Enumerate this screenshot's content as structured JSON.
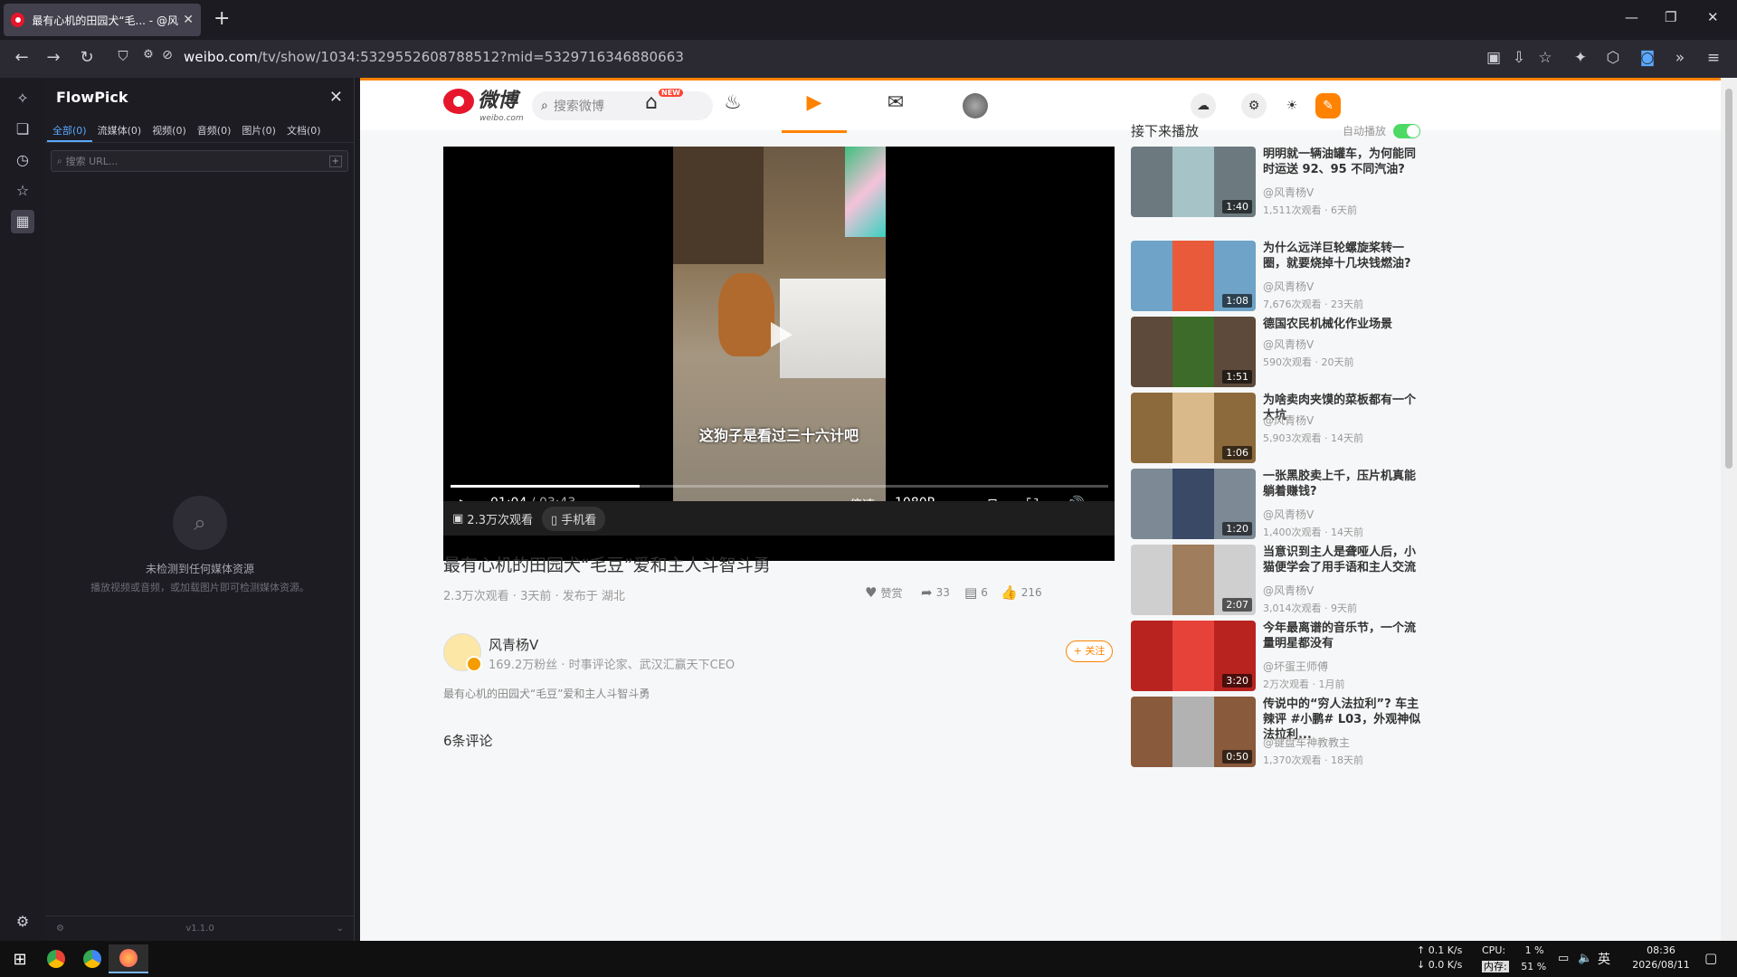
{
  "browser": {
    "tab_title": "最有心机的田园犬“毛... - @风青杨",
    "url_main": "weibo.com",
    "url_rest": "/tv/show/1034:5329552608788512?mid=5329716346880663"
  },
  "flowpick": {
    "title": "FlowPick",
    "tabs": [
      "全部(0)",
      "流媒体(0)",
      "视频(0)",
      "音频(0)",
      "图片(0)",
      "文档(0)"
    ],
    "search_placeholder": "搜索 URL...",
    "empty_title": "未检测到任何媒体资源",
    "empty_hint": "播放视频或音频，或加载图片即可检测媒体资源。",
    "version": "v1.1.0"
  },
  "weibo": {
    "logo_text": "微博",
    "logo_sub": "weibo.com",
    "search_placeholder": "搜索微博",
    "new_badge": "NEW"
  },
  "player": {
    "subtitle": "这狗子是看过三十六计吧",
    "current_time": "01:04",
    "duration": "03:43",
    "progress": 0.287,
    "speed_label": "倍速",
    "quality_label": "1080P",
    "views_label": "2.3万次观看",
    "mobile_label": "手机看"
  },
  "video": {
    "title": "最有心机的田园犬“毛豆”爱和主人斗智斗勇",
    "stats": "2.3万次观看 · 3天前 · 发布于 湖北",
    "reward_label": "赞赏",
    "shares": "33",
    "comments_count": "6",
    "likes": "216",
    "author_name": "风青杨V",
    "author_desc": "169.2万粉丝 · 时事评论家、武汉汇赢天下CEO",
    "follow_label": "+ 关注",
    "description": "最有心机的田园犬“毛豆”爱和主人斗智斗勇",
    "comments_header": "6条评论"
  },
  "sidebar": {
    "header": "接下来播放",
    "autoplay_label": "自动播放",
    "items": [
      {
        "title": "明明就一辆油罐车，为何能同时运送 92、95 不同汽油?",
        "author": "@风青杨V",
        "meta": "1,511次观看 · 6天前",
        "duration": "1:40"
      },
      {
        "title": "为什么远洋巨轮螺旋桨转一圈，就要烧掉十几块钱燃油?",
        "author": "@风青杨V",
        "meta": "7,676次观看 · 23天前",
        "duration": "1:08"
      },
      {
        "title": "德国农民机械化作业场景",
        "author": "@风青杨V",
        "meta": "590次观看 · 20天前",
        "duration": "1:51"
      },
      {
        "title": "为啥卖肉夹馍的菜板都有一个大坑",
        "author": "@风青杨V",
        "meta": "5,903次观看 · 14天前",
        "duration": "1:06"
      },
      {
        "title": "一张黑胶卖上千，压片机真能躺着赚钱?",
        "author": "@风青杨V",
        "meta": "1,400次观看 · 14天前",
        "duration": "1:20"
      },
      {
        "title": "当意识到主人是聋哑人后，小猫便学会了用手语和主人交流",
        "author": "@风青杨V",
        "meta": "3,014次观看 · 9天前",
        "duration": "2:07"
      },
      {
        "title": "今年最离谱的音乐节，一个流量明星都没有",
        "author": "@坏蛋王师傅",
        "meta": "2万次观看 · 1月前",
        "duration": "3:20"
      },
      {
        "title": "传说中的“穷人法拉利”? 车主辣评 #小鹏# L03，外观神似法拉利...",
        "author": "@键盘车神教教主",
        "meta": "1,370次观看 · 18天前",
        "duration": "0:50"
      }
    ]
  },
  "taskbar": {
    "net_up": "0.1 K/s",
    "net_down": "0.0 K/s",
    "cpu_label": "CPU:",
    "cpu_val": "1 %",
    "mem_label": "内存:",
    "mem_val": "51 %",
    "ime": "英",
    "time": "08:36",
    "date": "2026/08/11"
  }
}
